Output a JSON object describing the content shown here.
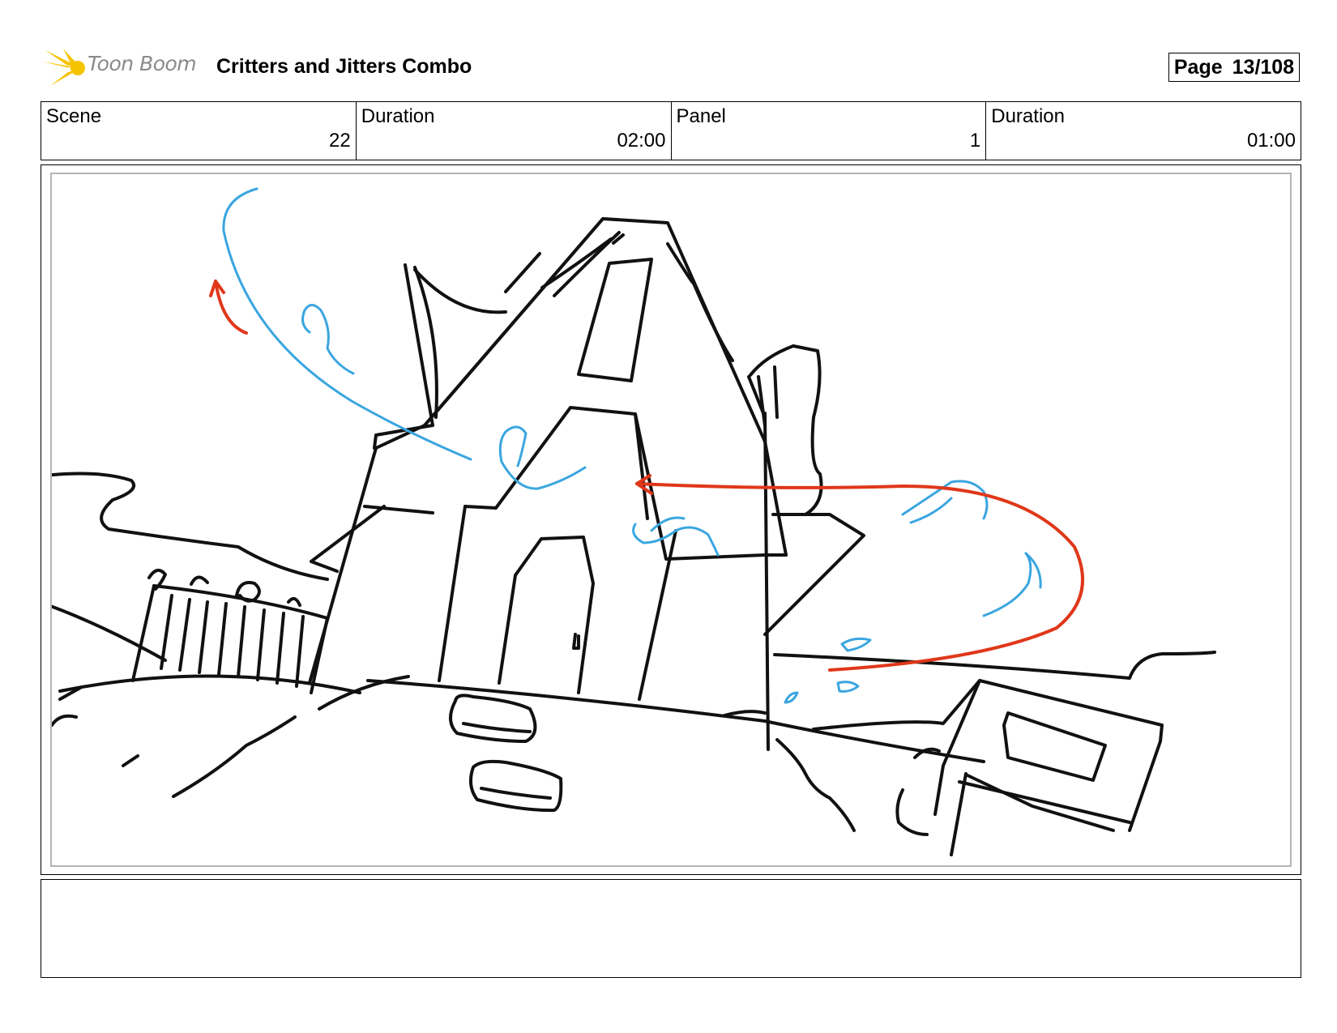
{
  "header": {
    "logo_text": "Toon Boom",
    "title": "Critters and Jitters Combo",
    "page_label": "Page",
    "page_number": "13/108"
  },
  "info": {
    "scene_label": "Scene",
    "scene_value": "22",
    "scene_duration_label": "Duration",
    "scene_duration_value": "02:00",
    "panel_label": "Panel",
    "panel_value": "1",
    "panel_duration_label": "Duration",
    "panel_duration_value": "01:00"
  },
  "colors": {
    "logo_yellow": "#f5c400",
    "sketch_black": "#111111",
    "sketch_blue": "#3aa6e0",
    "sketch_red": "#e0371a"
  }
}
